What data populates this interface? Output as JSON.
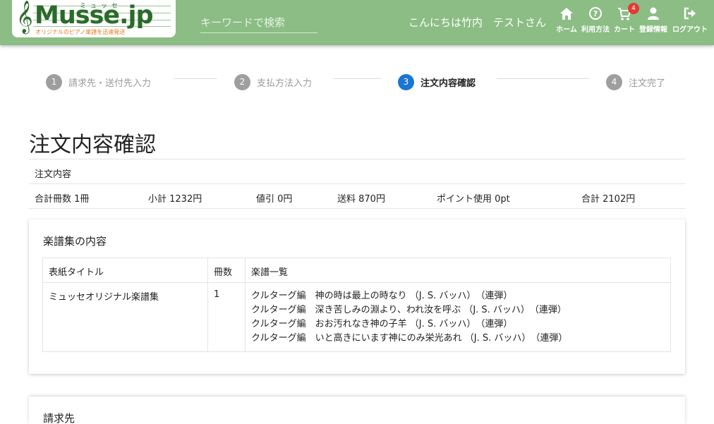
{
  "header": {
    "logo_text": "Musse.jp",
    "logo_kana": "ミュッセ",
    "logo_tagline": "オリジナルのピアノ楽譜を迅速発送",
    "search_placeholder": "キーワードで検索",
    "greeting": "こんにちは竹内　テストさん",
    "nav": [
      {
        "label": "ホーム",
        "icon": "home-icon"
      },
      {
        "label": "利用方法",
        "icon": "help-icon"
      },
      {
        "label": "カート",
        "icon": "cart-icon",
        "badge": "4"
      },
      {
        "label": "登録情報",
        "icon": "user-icon"
      },
      {
        "label": "ログアウト",
        "icon": "logout-icon"
      }
    ],
    "colors": {
      "header_bg": "#8bbd84",
      "logo_green": "#2a6b2a",
      "badge": "#e53935"
    }
  },
  "stepper": {
    "steps": [
      {
        "num": "1",
        "label": "請求先・送付先入力"
      },
      {
        "num": "2",
        "label": "支払方法入力"
      },
      {
        "num": "3",
        "label": "注文内容確認"
      },
      {
        "num": "4",
        "label": "注文完了"
      }
    ],
    "active_step": 3,
    "active_color": "#1976d2"
  },
  "page": {
    "title": "注文内容確認"
  },
  "summary": {
    "heading": "注文内容",
    "total_books": "合計冊数 1冊",
    "subtotal": "小計 1232円",
    "discount": "値引 0円",
    "shipping": "送料 870円",
    "points": "ポイント使用 0pt",
    "total": "合計 2102円"
  },
  "collection_card": {
    "title": "楽譜集の内容",
    "columns": [
      "表紙タイトル",
      "冊数",
      "楽譜一覧"
    ],
    "row": {
      "cover_title": "ミュッセオリジナル楽譜集",
      "count": "1",
      "scores": [
        "クルターグ編　神の時は最上の時なり （J. S. バッハ）　（連弾）",
        "クルターグ編　深き苦しみの淵より、われ汝を呼ぶ （J. S. バッハ）　（連弾）",
        "クルターグ編　おお汚れなき神の子羊 （J. S. バッハ）　（連弾）",
        "クルターグ編　いと高きにいます神にのみ栄光あれ （J. S. バッハ）　（連弾）"
      ]
    }
  },
  "billing_card": {
    "title": "請求先"
  }
}
